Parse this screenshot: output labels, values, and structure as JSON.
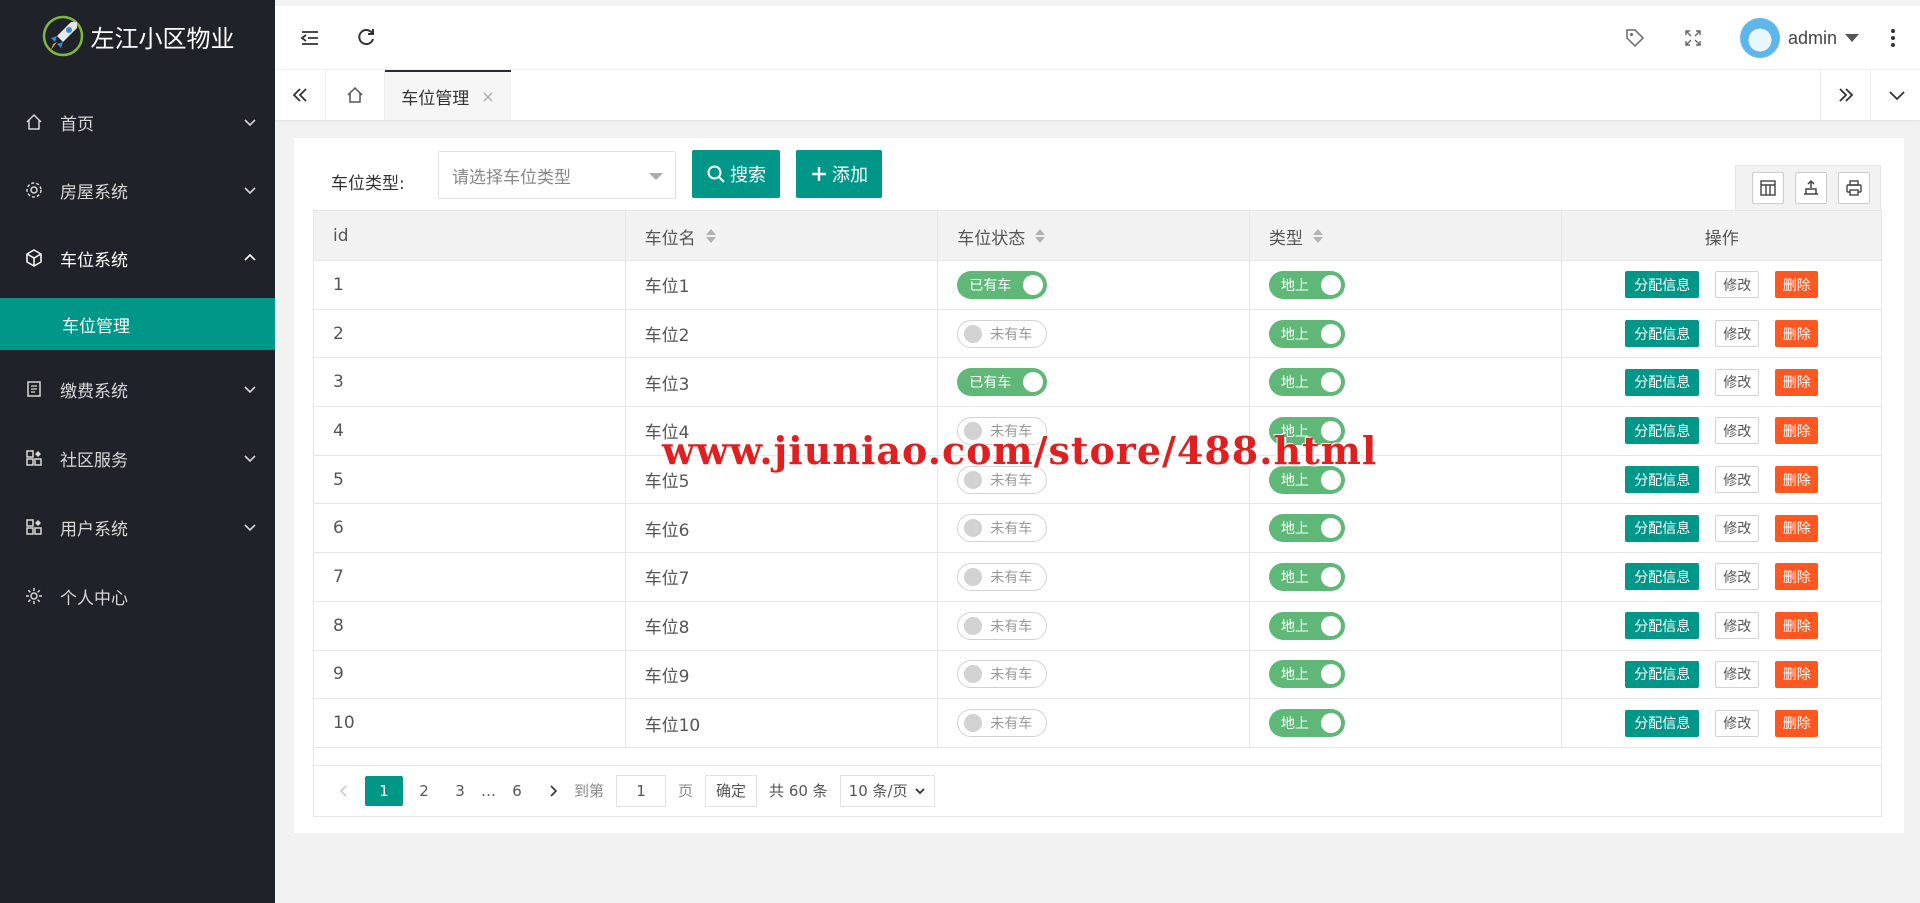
{
  "app": {
    "title": "左江小区物业"
  },
  "sidebar": {
    "items": [
      {
        "label": "首页",
        "icon": "home-icon",
        "expanded": false
      },
      {
        "label": "房屋系统",
        "icon": "gear-icon",
        "expanded": false
      },
      {
        "label": "车位系统",
        "icon": "cube-icon",
        "expanded": true
      },
      {
        "label": "缴费系统",
        "icon": "bill-icon",
        "expanded": false
      },
      {
        "label": "社区服务",
        "icon": "apps-icon",
        "expanded": false
      },
      {
        "label": "用户系统",
        "icon": "apps-icon",
        "expanded": false
      },
      {
        "label": "个人中心",
        "icon": "settings-icon",
        "expanded": false
      }
    ],
    "active_sub": "车位管理"
  },
  "header": {
    "user": "admin"
  },
  "tabs": {
    "active": "车位管理",
    "close": "×"
  },
  "filter": {
    "label": "车位类型:",
    "placeholder": "请选择车位类型",
    "search_label": "搜索",
    "add_label": "添加"
  },
  "table": {
    "columns": [
      "id",
      "车位名",
      "车位状态",
      "类型",
      "操作"
    ],
    "actions": {
      "assign": "分配信息",
      "edit": "修改",
      "delete": "删除"
    },
    "rows": [
      {
        "id": "1",
        "name": "车位1",
        "status": "已有车",
        "status_on": true,
        "type": "地上"
      },
      {
        "id": "2",
        "name": "车位2",
        "status": "未有车",
        "status_on": false,
        "type": "地上"
      },
      {
        "id": "3",
        "name": "车位3",
        "status": "已有车",
        "status_on": true,
        "type": "地上"
      },
      {
        "id": "4",
        "name": "车位4",
        "status": "未有车",
        "status_on": false,
        "type": "地上"
      },
      {
        "id": "5",
        "name": "车位5",
        "status": "未有车",
        "status_on": false,
        "type": "地上"
      },
      {
        "id": "6",
        "name": "车位6",
        "status": "未有车",
        "status_on": false,
        "type": "地上"
      },
      {
        "id": "7",
        "name": "车位7",
        "status": "未有车",
        "status_on": false,
        "type": "地上"
      },
      {
        "id": "8",
        "name": "车位8",
        "status": "未有车",
        "status_on": false,
        "type": "地上"
      },
      {
        "id": "9",
        "name": "车位9",
        "status": "未有车",
        "status_on": false,
        "type": "地上"
      },
      {
        "id": "10",
        "name": "车位10",
        "status": "未有车",
        "status_on": false,
        "type": "地上"
      }
    ]
  },
  "pagination": {
    "pages": [
      "1",
      "2",
      "3"
    ],
    "ellipsis": "…",
    "last": "6",
    "goto_label": "到第",
    "goto_value": "1",
    "page_unit": "页",
    "confirm": "确定",
    "total": "共 60 条",
    "page_size": "10 条/页"
  },
  "watermark": "www.jiuniao.com/store/488.html",
  "colors": {
    "sidebar": "#20222a",
    "accent": "#009688",
    "switch_on": "#5fb878",
    "danger": "#ff5722"
  }
}
